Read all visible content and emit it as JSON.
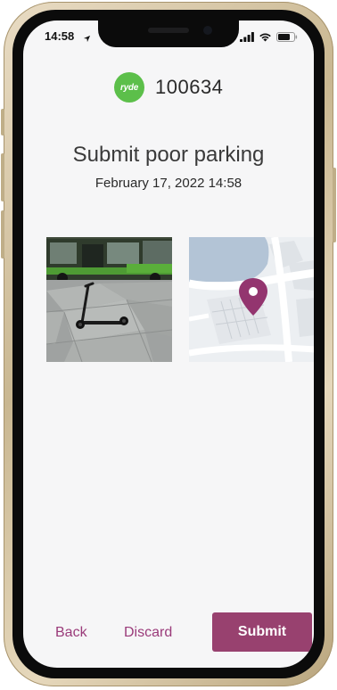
{
  "status_bar": {
    "time": "14:58"
  },
  "header": {
    "logo_text": "ryde",
    "vehicle_id": "100634"
  },
  "main": {
    "title": "Submit poor parking",
    "datetime": "February 17, 2022 14:58"
  },
  "footer": {
    "back_label": "Back",
    "discard_label": "Discard",
    "submit_label": "Submit"
  },
  "colors": {
    "accent": "#98416f",
    "link": "#9a3b7a",
    "logo_green": "#5cbf4a"
  },
  "icons": [
    "location-arrow-icon",
    "signal-icon",
    "wifi-icon",
    "battery-icon",
    "map-pin-icon"
  ]
}
